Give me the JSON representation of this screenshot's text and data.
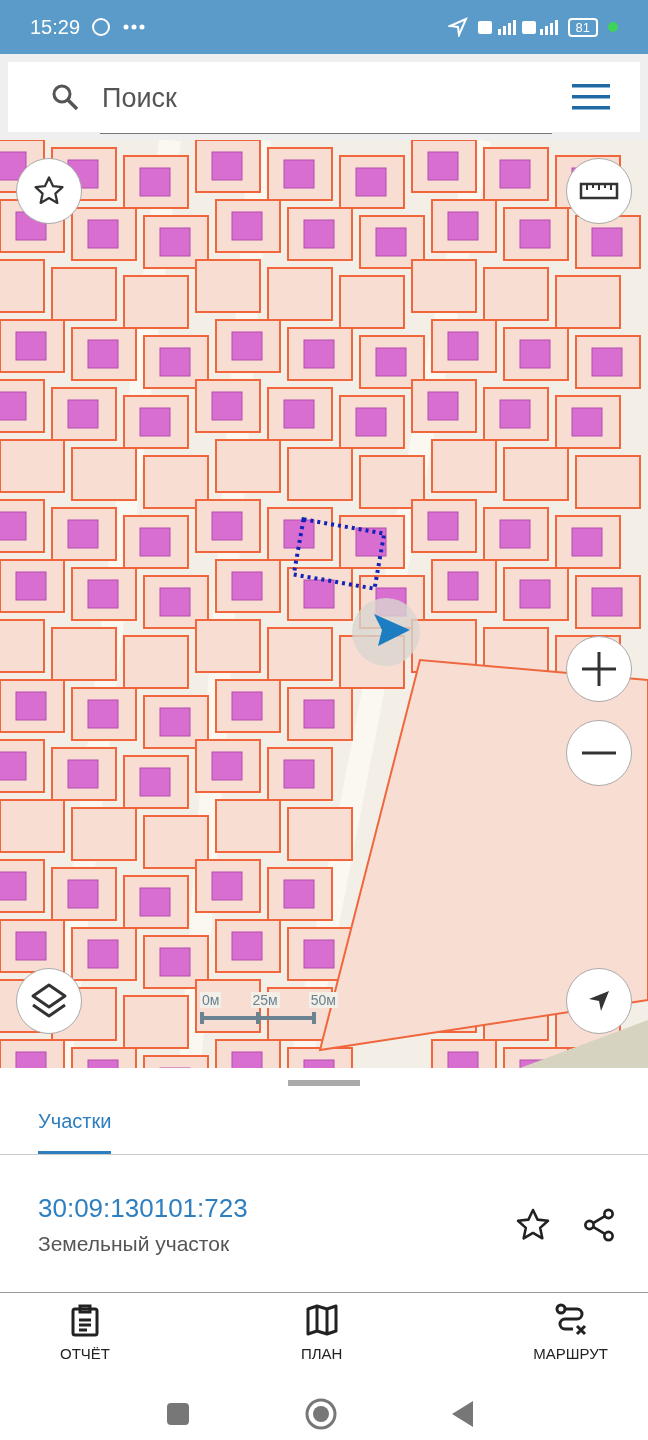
{
  "status_bar": {
    "time": "15:29",
    "battery": "81"
  },
  "search": {
    "placeholder": "Поиск"
  },
  "map": {
    "scale_labels": [
      "0м",
      "25м",
      "50м"
    ]
  },
  "tabs": [
    {
      "label": "Участки",
      "selected": true
    }
  ],
  "result": {
    "number": "30:09:130101:723",
    "type": "Земельный участок"
  },
  "bottom_nav": [
    {
      "label": "ОТЧЁТ",
      "kind": "report"
    },
    {
      "label": "ПЛАН",
      "kind": "map"
    },
    {
      "label": "МАРШРУТ",
      "kind": "route"
    }
  ]
}
